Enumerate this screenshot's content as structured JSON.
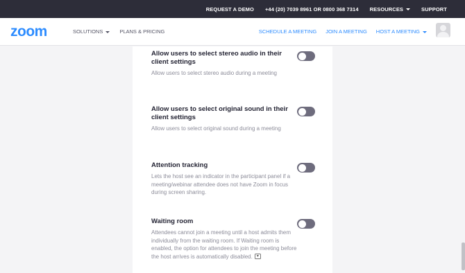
{
  "topbar": {
    "request_demo": "REQUEST A DEMO",
    "phone": "+44 (20) 7039 8961 OR 0800 368 7314",
    "resources": "RESOURCES",
    "support": "SUPPORT"
  },
  "navbar": {
    "logo": "zoom",
    "solutions": "SOLUTIONS",
    "plans": "PLANS & PRICING",
    "schedule": "SCHEDULE A MEETING",
    "join": "JOIN A MEETING",
    "host": "HOST A MEETING"
  },
  "settings": [
    {
      "title": "Allow users to select stereo audio in their client settings",
      "desc": "Allow users to select stereo audio during a meeting",
      "enabled": false
    },
    {
      "title": "Allow users to select original sound in their client settings",
      "desc": "Allow users to select original sound during a meeting",
      "enabled": false
    },
    {
      "title": "Attention tracking",
      "desc": "Lets the host see an indicator in the participant panel if a meeting/webinar attendee does not have Zoom in focus during screen sharing.",
      "enabled": false
    },
    {
      "title": "Waiting room",
      "desc": "Attendees cannot join a meeting until a host admits them individually from the waiting room. If Waiting room is enabled, the option for attendees to join the meeting before the host arrives is automatically disabled.",
      "enabled": false
    }
  ],
  "colors": {
    "brand": "#2d8cff",
    "topbar_bg": "#2d2d39",
    "toggle_off": "#6e6c7d"
  }
}
